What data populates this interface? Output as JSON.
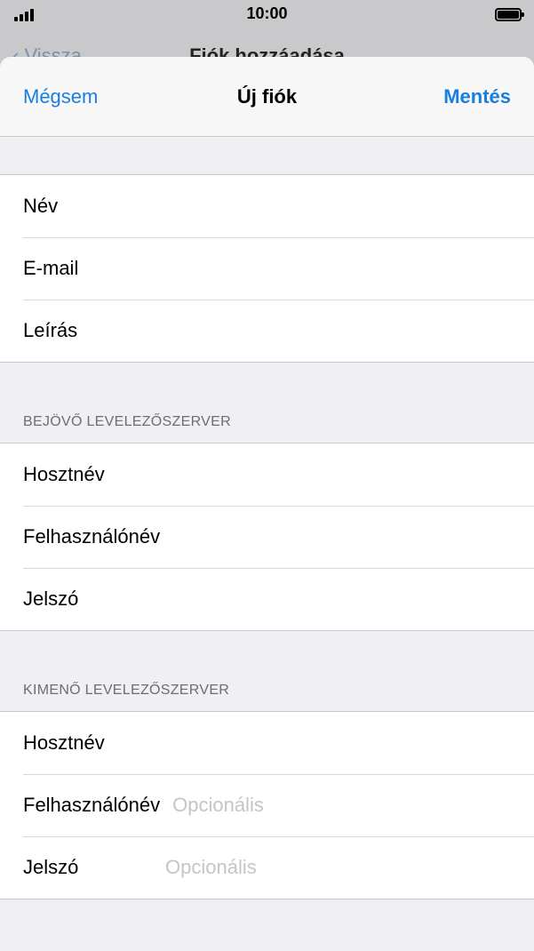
{
  "status": {
    "time": "10:00"
  },
  "background": {
    "back_label": "Vissza",
    "title": "Fiók hozzáadása"
  },
  "nav": {
    "cancel": "Mégsem",
    "title": "Új fiók",
    "save": "Mentés"
  },
  "account_section": {
    "rows": [
      {
        "label": "Név"
      },
      {
        "label": "E-mail"
      },
      {
        "label": "Leírás"
      }
    ]
  },
  "incoming_section": {
    "header": "BEJÖVŐ LEVELEZŐSZERVER",
    "rows": [
      {
        "label": "Hosztnév"
      },
      {
        "label": "Felhasználónév"
      },
      {
        "label": "Jelszó"
      }
    ]
  },
  "outgoing_section": {
    "header": "KIMENŐ LEVELEZŐSZERVER",
    "rows": [
      {
        "label": "Hosztnév"
      },
      {
        "label": "Felhasználónév",
        "placeholder": "Opcionális"
      },
      {
        "label": "Jelszó",
        "placeholder": "Opcionális"
      }
    ]
  }
}
